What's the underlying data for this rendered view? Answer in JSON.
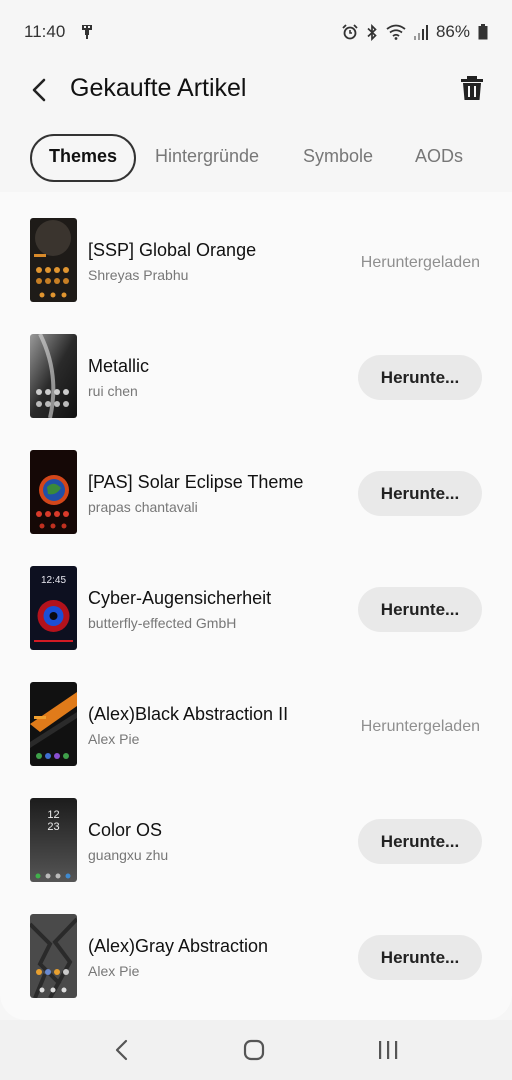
{
  "status_bar": {
    "time": "11:40",
    "battery": "86%",
    "icons": [
      "usb-icon",
      "alarm-icon",
      "bluetooth-icon",
      "wifi-icon",
      "signal-icon",
      "battery-icon"
    ]
  },
  "header": {
    "title": "Gekaufte Artikel",
    "back_icon": "back-arrow-icon",
    "delete_icon": "trash-icon"
  },
  "tabs": [
    {
      "label": "Themes",
      "active": true
    },
    {
      "label": "Hintergründe",
      "active": false
    },
    {
      "label": "Symbole",
      "active": false
    },
    {
      "label": "AODs",
      "active": false
    }
  ],
  "items": [
    {
      "title": "[SSP] Global Orange",
      "author": "Shreyas Prabhu",
      "status": "Heruntergeladen"
    },
    {
      "title": "Metallic",
      "author": "rui chen",
      "action": "Herunte..."
    },
    {
      "title": "[PAS] Solar Eclipse Theme",
      "author": "prapas chantavali",
      "action": "Herunte..."
    },
    {
      "title": "Cyber-Augensicherheit",
      "author": "butterfly-effected GmbH",
      "action": "Herunte..."
    },
    {
      "title": "(Alex)Black Abstraction II",
      "author": "Alex Pie",
      "status": "Heruntergeladen"
    },
    {
      "title": "Color OS",
      "author": "guangxu zhu",
      "action": "Herunte...",
      "thumb_clock": [
        "12",
        "23"
      ]
    },
    {
      "title": "(Alex)Gray Abstraction",
      "author": "Alex Pie",
      "action": "Herunte..."
    }
  ],
  "thumb_texts": {
    "cyber_clock": "12:45"
  },
  "nav": {
    "back_icon": "nav-back-icon",
    "home_icon": "nav-home-icon",
    "recents_icon": "nav-recents-icon"
  }
}
